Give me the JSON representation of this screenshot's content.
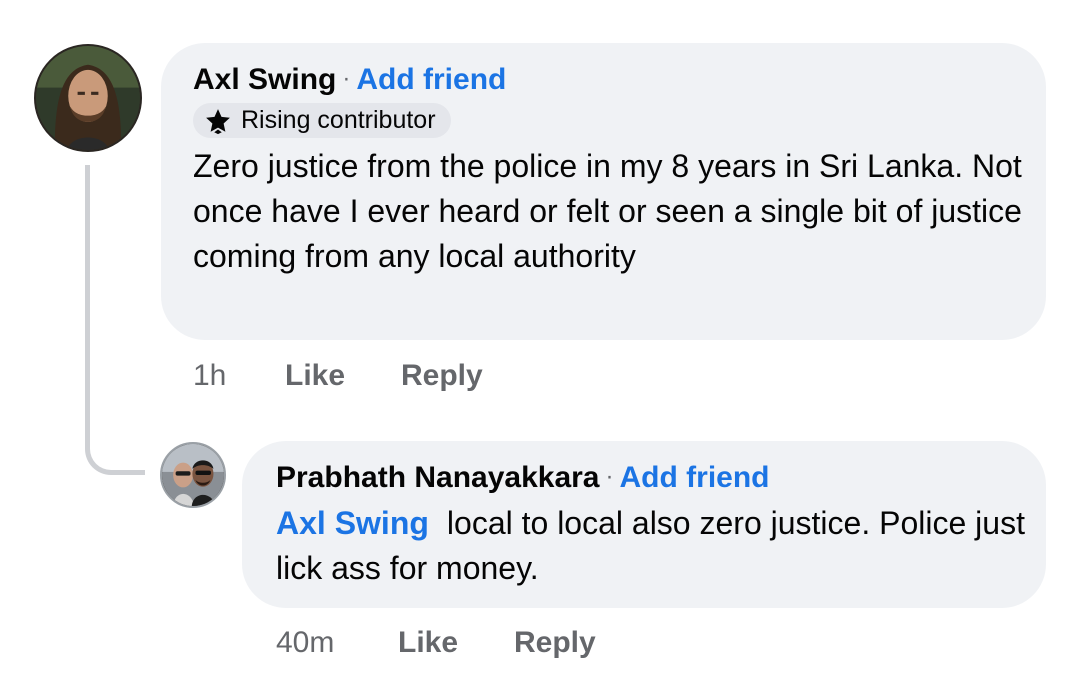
{
  "comments": [
    {
      "author": "Axl Swing",
      "separator": "·",
      "add_friend": "Add friend",
      "badge": {
        "icon": "star-icon",
        "label": "Rising contributor"
      },
      "text": "Zero justice from the police in my 8 years in Sri Lanka.  Not once have I ever heard or felt or seen a single bit of justice coming from any local authority",
      "time": "1h",
      "like": "Like",
      "reply": "Reply"
    },
    {
      "author": "Prabhath Nanayakkara",
      "separator": "·",
      "add_friend": "Add friend",
      "mention": "Axl Swing",
      "text": "local to local also zero justice. Police just lick ass for money.",
      "time": "40m",
      "like": "Like",
      "reply": "Reply"
    }
  ],
  "colors": {
    "bubble": "#f0f2f5",
    "link": "#1b74e4",
    "secondary_text": "#65676b",
    "thread_line": "#ced0d4"
  }
}
